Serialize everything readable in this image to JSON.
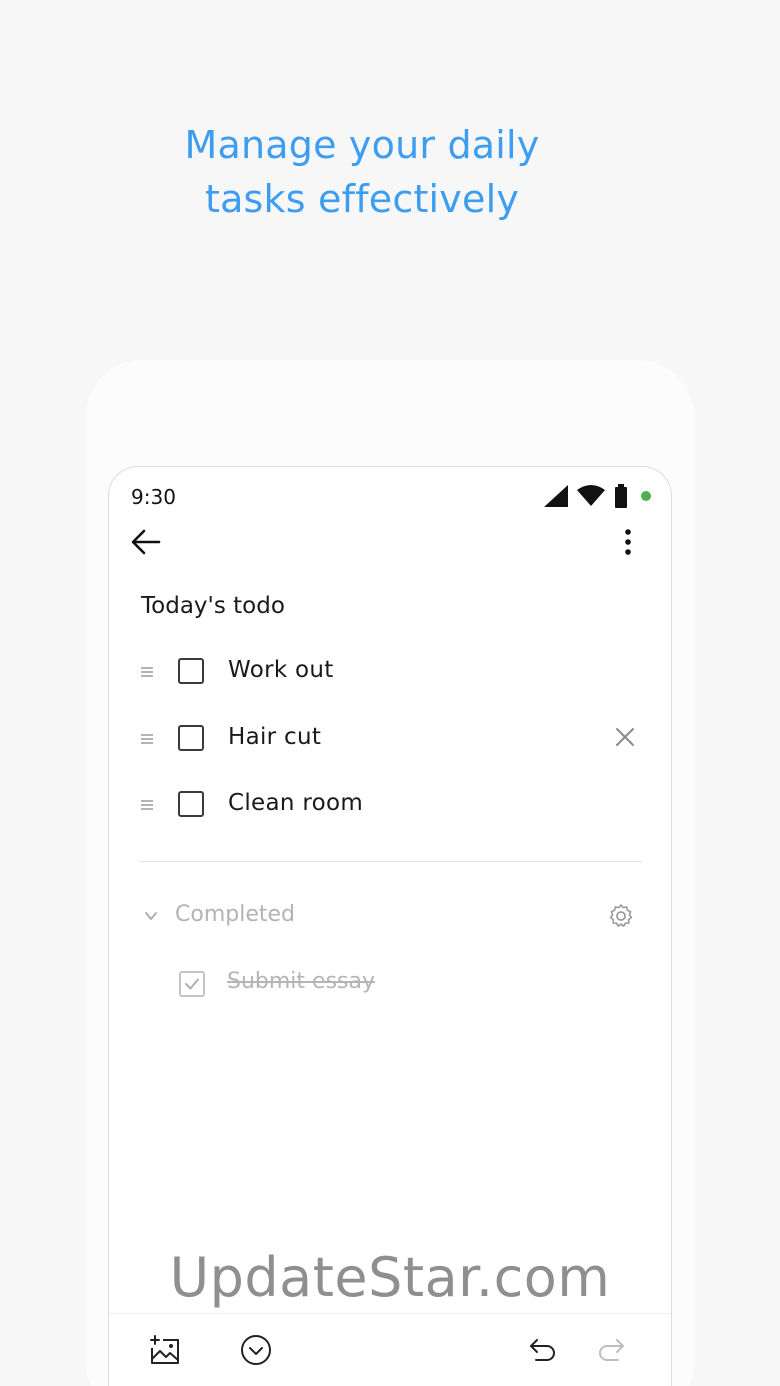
{
  "headline": {
    "line1": "Manage your daily",
    "line2": "tasks effectively"
  },
  "status_bar": {
    "time": "9:30",
    "icons": [
      "signal-icon",
      "wifi-icon",
      "battery-icon",
      "green-dot"
    ]
  },
  "appbar": {
    "back_icon": "arrow-left-icon",
    "more_icon": "more-vertical-icon"
  },
  "note": {
    "title": "Today's todo",
    "items": [
      {
        "label": "Work out",
        "checked": false
      },
      {
        "label": "Hair cut",
        "checked": false
      },
      {
        "label": "Clean room",
        "checked": false
      }
    ],
    "completed": {
      "label": "Completed",
      "items": [
        {
          "label": "Submit essay",
          "checked": true
        }
      ]
    }
  },
  "toolbar": {
    "icons": [
      "add-image-icon",
      "checklist-circle-icon",
      "undo-icon",
      "redo-icon"
    ]
  },
  "watermark": "UpdateStar.com",
  "colors": {
    "accent": "#3d9df0",
    "background": "#f7f7f7",
    "status_dot": "#4caf50",
    "muted_text": "#b3b3b3"
  }
}
